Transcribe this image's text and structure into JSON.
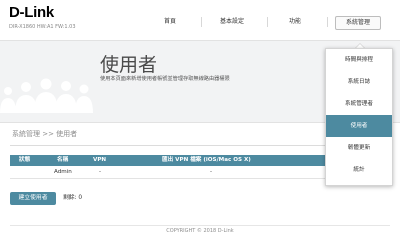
{
  "brand": {
    "logo": "D-Link",
    "model": "DIR-X1860 HW:A1 FW:1.03"
  },
  "nav": {
    "home": "首頁",
    "basic": "基本設定",
    "features": "功能",
    "management": "系統管理"
  },
  "banner": {
    "title": "使用者",
    "description": "使用本頁面來新增使用者帳號並管理存取無線路由器權限"
  },
  "breadcrumb": "系統管理 >> 使用者",
  "table": {
    "headers": {
      "status": "狀態",
      "name": "名稱",
      "vpn": "VPN",
      "vpn_file": "匯出 VPN 檔案 (iOS/Mac OS X)"
    },
    "rows": [
      {
        "status": "",
        "name": "Admin",
        "vpn": "-",
        "vpn_file": "-"
      }
    ]
  },
  "create_user": {
    "label": "建立使用者"
  },
  "remaining": {
    "label": "剩餘:",
    "count": "0"
  },
  "dropdown": {
    "items": [
      "時間與排程",
      "系統日誌",
      "系統管理者",
      "使用者",
      "韌體更新",
      "統計"
    ],
    "active_index": 3
  },
  "footer": {
    "copyright": "COPYRIGHT © 2018 D-Link"
  },
  "colors": {
    "accent": "#4d8aa0",
    "banner_bg": "#f2f3f4",
    "silhouette": "#ffffff"
  },
  "icons": {
    "banner": "people-group-icon"
  }
}
